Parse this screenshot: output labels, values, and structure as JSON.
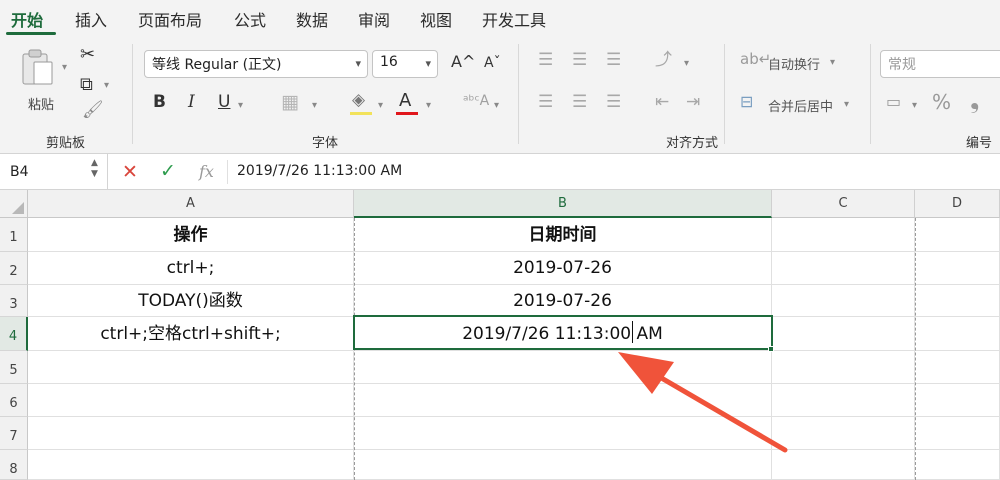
{
  "ribbon_tabs": [
    "开始",
    "插入",
    "页面布局",
    "公式",
    "数据",
    "审阅",
    "视图",
    "开发工具"
  ],
  "clipboard": {
    "paste_label": "粘贴",
    "group_label": "剪贴板"
  },
  "font": {
    "name": "等线 Regular (正文)",
    "size": "16",
    "group_label": "字体",
    "grow_icon": "A^",
    "shrink_icon": "Aˇ"
  },
  "alignment": {
    "wrap_text": "自动换行",
    "merge_center": "合并后居中",
    "group_label": "对齐方式"
  },
  "number": {
    "format": "常规",
    "group_label": "编号",
    "percent": "%",
    "comma": "❟"
  },
  "formula_bar": {
    "name_box": "B4",
    "fx": "fx",
    "value": "2019/7/26  11:13:00 AM"
  },
  "columns": [
    "A",
    "B",
    "C",
    "D"
  ],
  "rows": [
    "1",
    "2",
    "3",
    "4",
    "5",
    "6",
    "7",
    "8"
  ],
  "cells": {
    "A1": "操作",
    "B1": "日期时间",
    "A2": "ctrl+;",
    "B2": "2019-07-26",
    "A3": "TODAY()函数",
    "B3": "2019-07-26",
    "A4": "ctrl+;空格ctrl+shift+;",
    "B4": "2019/7/26  11:13:00 AM"
  },
  "colors": {
    "accent": "#1e6b3c",
    "arrow": "#f0533a"
  }
}
